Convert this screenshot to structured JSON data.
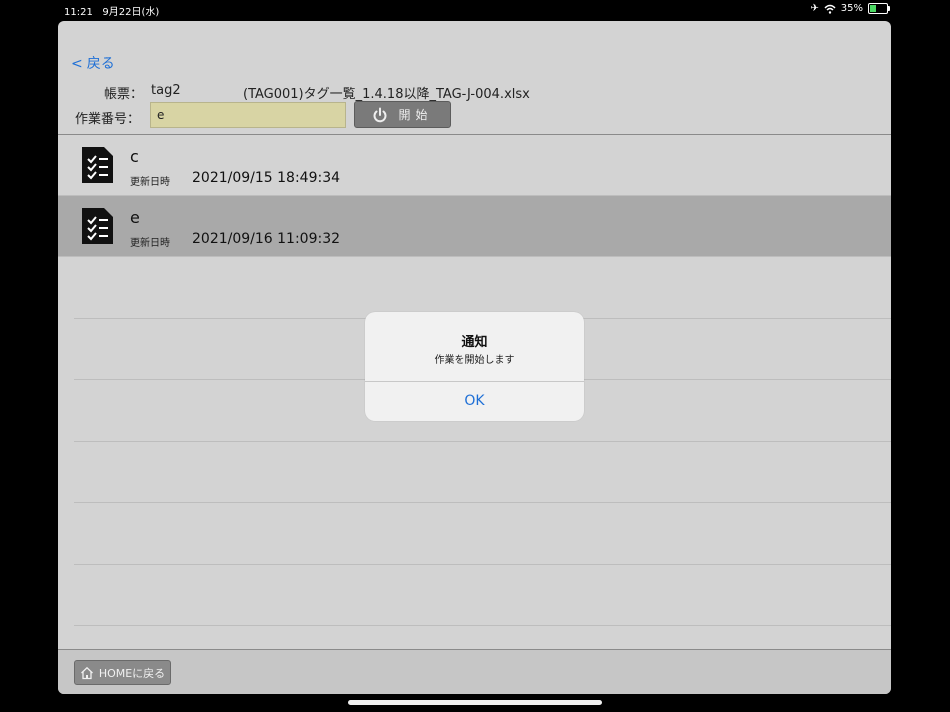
{
  "status_bar": {
    "time": "11:21",
    "date": "9月22日(水)",
    "battery": "35%",
    "battery_level": 0.35
  },
  "nav": {
    "back_label": "戻る"
  },
  "form": {
    "report_label": "帳票：",
    "report_value": "tag2",
    "file_name": "(TAG001)タグ一覧_1.4.18以降_TAG-J-004.xlsx",
    "job_label": "作業番号：",
    "job_value": "e",
    "start_label": "開始"
  },
  "list": {
    "items": [
      {
        "title": "c",
        "sub_label": "更新日時",
        "datetime": "2021/09/15 18:49:34",
        "selected": false
      },
      {
        "title": "e",
        "sub_label": "更新日時",
        "datetime": "2021/09/16 11:09:32",
        "selected": true
      }
    ]
  },
  "footer": {
    "home_label": "HOMEに戻る"
  },
  "alert": {
    "title": "通知",
    "message": "作業を開始します",
    "ok_label": "OK"
  },
  "colors": {
    "accent": "#1e6fd6",
    "input_bg": "#d8d4a4",
    "selected_row": "#a9a9a9"
  }
}
